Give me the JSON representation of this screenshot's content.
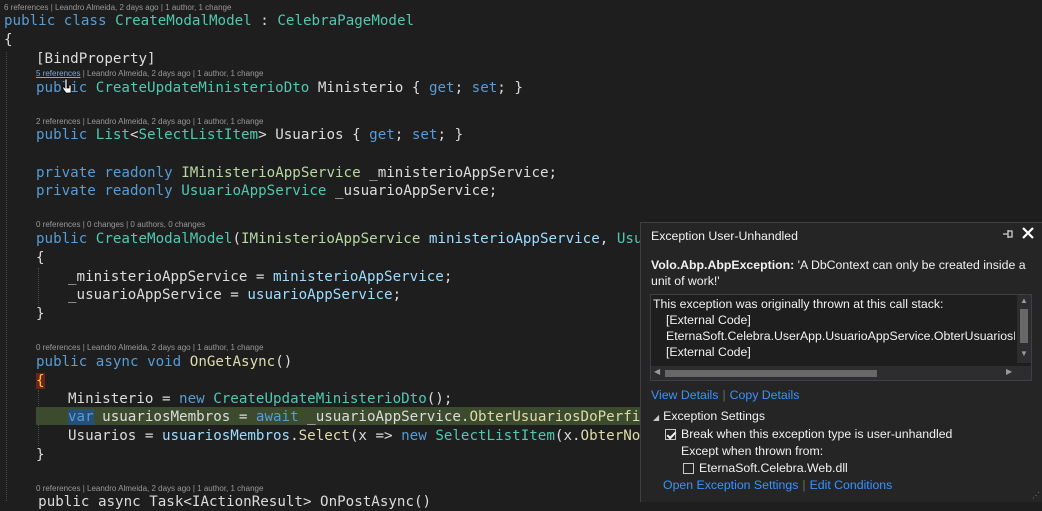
{
  "editor": {
    "lens_class": "6 references | Leandro Almeida, 2 days ago | 1 author, 1 change",
    "class_decl": {
      "kw1": "public",
      "kw2": "class",
      "name": "CreateModalModel",
      "colon": " : ",
      "base": "CelebraPageModel"
    },
    "open_brace": "{",
    "bind_attr": "[BindProperty]",
    "lens_ministerio_refs": "5 references",
    "lens_ministerio_rest": " | Leandro Almeida, 2 days ago | 1 author, 1 change",
    "prop_ministerio": {
      "kw": "public",
      "type": "CreateUpdateMinisterioDto",
      "name": " Ministerio { ",
      "get": "get",
      "semi1": "; ",
      "set": "set",
      "end": "; }"
    },
    "lens_usuarios": "2 references | Leandro Almeida, 2 days ago | 1 author, 1 change",
    "prop_usuarios": {
      "kw": "public",
      "type1": "List",
      "lt": "<",
      "type2": "SelectListItem",
      "gt": ">",
      "name": " Usuarios { ",
      "get": "get",
      "semi1": "; ",
      "set": "set",
      "end": "; }"
    },
    "field1": {
      "kw1": "private",
      "kw2": "readonly",
      "type": "IMinisterioAppService",
      "name": " _ministerioAppService;"
    },
    "field2": {
      "kw1": "private",
      "kw2": "readonly",
      "type": "UsuarioAppService",
      "name": " _usuarioAppService;"
    },
    "lens_ctor": "0 references | 0 changes | 0 authors, 0 changes",
    "ctor": {
      "kw": "public",
      "name": "CreateModalModel",
      "p": "(",
      "t1": "IMinisterioAppService",
      "a1": " ministerioAppService",
      "rest": ", ",
      "t2": "Usuari"
    },
    "ctor_open": "{",
    "assign1": {
      "lhs": "_ministerioAppService = ",
      "rhs": "ministerioAppService",
      "end": ";"
    },
    "assign2": {
      "lhs": "_usuarioAppService = ",
      "rhs": "usuarioAppService",
      "end": ";"
    },
    "ctor_close": "}",
    "lens_onget": "0 references | Leandro Almeida, 2 days ago | 1 author, 1 change",
    "onget": {
      "kw1": "public",
      "kw2": "async",
      "kw3": "void",
      "name": "OnGetAsync",
      "end": "()"
    },
    "onget_open": "{",
    "stmt1": {
      "lhs": "Ministerio = ",
      "kw": "new",
      "type": "CreateUpdateMinisterioDto",
      "end": "();"
    },
    "stmt2": {
      "kw": "var",
      "rest1": " usuariosMembros = ",
      "kw2": "await",
      "rest2": " _usuarioAppService.",
      "method": "ObterUsuariosDoPerfilAs"
    },
    "stmt3": {
      "lhs": "Usuarios = ",
      "v": "usuariosMembros",
      "dot": ".",
      "m": "Select",
      "p": "(x => ",
      "kw": "new",
      "t": "SelectListItem",
      "r": "(x.",
      "m2": "ObterNomeC"
    },
    "onget_close": "}",
    "lens_onpost": "0 references | Leandro Almeida, 2 days ago | 1 author, 1 change",
    "onpost_partial": "    public async Task<IActionResult> OnPostAsync()"
  },
  "exception": {
    "title": "Exception User-Unhandled",
    "pin_icon": "pin-icon",
    "close_icon": "close-icon",
    "type": "Volo.Abp.AbpException:",
    "message": " 'A DbContext can only be created inside a unit of work!'",
    "stack_heading": "This exception was originally thrown at this call stack:",
    "stack": [
      "[External Code]",
      "EternaSoft.Celebra.UserApp.UsuarioAppService.ObterUsuariosDoPerfil",
      "[External Code]"
    ],
    "view_details": "View Details",
    "copy_details": "Copy Details",
    "settings_title": "Exception Settings",
    "break_label": "Break when this exception type is user-unhandled",
    "except_label": "Except when thrown from:",
    "module_label": "EternaSoft.Celebra.Web.dll",
    "open_settings": "Open Exception Settings",
    "edit_conditions": "Edit Conditions",
    "separator": "|",
    "break_checked": true,
    "module_checked": false
  }
}
